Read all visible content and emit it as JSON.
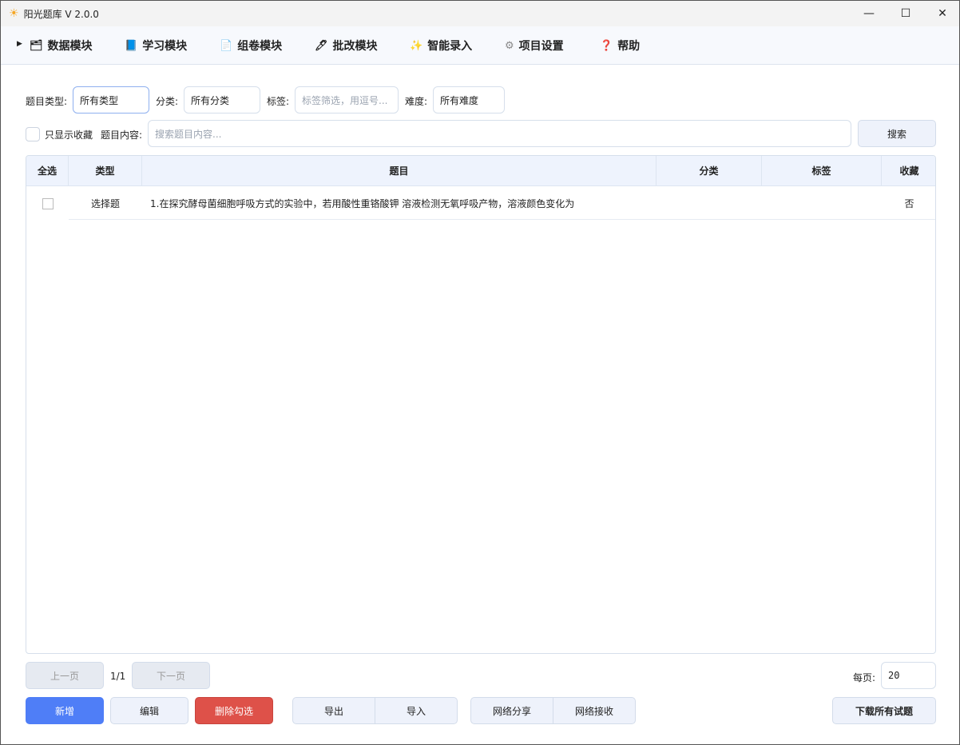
{
  "window": {
    "title": "阳光题库 V 2.0.0",
    "icon": "sun-icon"
  },
  "menu": [
    {
      "label": "数据模块",
      "icon": "folder-icon",
      "glyph": "🗂"
    },
    {
      "label": "学习模块",
      "icon": "book-icon",
      "glyph": "📘"
    },
    {
      "label": "组卷模块",
      "icon": "paper-stack-icon",
      "glyph": "📄"
    },
    {
      "label": "批改模块",
      "icon": "pen-icon",
      "glyph": "🖊"
    },
    {
      "label": "智能录入",
      "icon": "sparkles-icon",
      "glyph": "✨"
    },
    {
      "label": "项目设置",
      "icon": "gear-icon",
      "glyph": "⚙"
    },
    {
      "label": "帮助",
      "icon": "question-icon",
      "glyph": "❓"
    }
  ],
  "filters": {
    "type_label": "题目类型:",
    "type_value": "所有类型",
    "category_label": "分类:",
    "category_value": "所有分类",
    "tag_label": "标签:",
    "tag_placeholder": "标签筛选，用逗号...",
    "difficulty_label": "难度:",
    "difficulty_value": "所有难度",
    "favorites_label": "只显示收藏",
    "content_label": "题目内容:",
    "content_placeholder": "搜索题目内容...",
    "search_button": "搜索"
  },
  "table": {
    "headers": [
      "全选",
      "类型",
      "题目",
      "分类",
      "标签",
      "收藏"
    ],
    "rows": [
      {
        "type": "选择题",
        "question": "1.在探究酵母菌细胞呼吸方式的实验中，若用酸性重铬酸钾 溶液检测无氧呼吸产物，溶液颜色变化为",
        "category": "",
        "tags": "",
        "favorite": "否"
      }
    ]
  },
  "pagination": {
    "prev": "上一页",
    "page": "1/1",
    "next": "下一页",
    "per_page_label": "每页:",
    "per_page": "20"
  },
  "actions": {
    "add": "新增",
    "edit": "编辑",
    "delete": "删除勾选",
    "export": "导出",
    "import": "导入",
    "share": "网络分享",
    "receive": "网络接收",
    "download_all": "下载所有试题"
  },
  "colors": {
    "primary": "#4f7ef7",
    "danger": "#de5149"
  }
}
